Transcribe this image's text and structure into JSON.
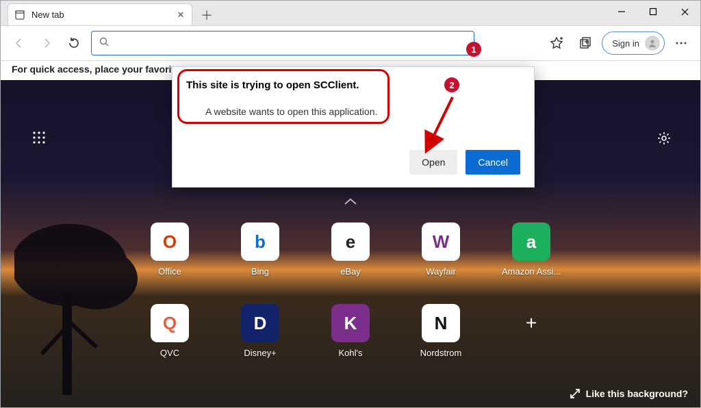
{
  "tab": {
    "title": "New tab"
  },
  "toolbar": {
    "signin_label": "Sign in"
  },
  "favhint": "For quick access, place your favorite",
  "dialog": {
    "title_prefix": "This site is trying to open ",
    "title_app": "SCClient.",
    "subtitle": "A website wants to open this application.",
    "open_label": "Open",
    "cancel_label": "Cancel"
  },
  "tiles": {
    "row1": [
      {
        "label": "Office",
        "bg": "#fff",
        "glyph": "O",
        "glyphColor": "#d83b01"
      },
      {
        "label": "Bing",
        "bg": "#fff",
        "glyph": "b",
        "glyphColor": "#0b6dd4"
      },
      {
        "label": "eBay",
        "bg": "#fff",
        "glyph": "e",
        "glyphColor": "#222"
      },
      {
        "label": "Wayfair",
        "bg": "#fff",
        "glyph": "W",
        "glyphColor": "#7a2e8f"
      },
      {
        "label": "Amazon Assi...",
        "bg": "#1caf5d",
        "glyph": "a",
        "glyphColor": "#fff"
      }
    ],
    "row2": [
      {
        "label": "QVC",
        "bg": "#fff",
        "glyph": "Q",
        "glyphColor": "#e06040"
      },
      {
        "label": "Disney+",
        "bg": "#12236b",
        "glyph": "D",
        "glyphColor": "#fff"
      },
      {
        "label": "Kohl's",
        "bg": "#7b2f8a",
        "glyph": "K",
        "glyphColor": "#fff"
      },
      {
        "label": "Nordstrom",
        "bg": "#fff",
        "glyph": "N",
        "glyphColor": "#111"
      }
    ]
  },
  "likebg": "Like this background?",
  "annotations": {
    "n1": "1",
    "n2": "2"
  }
}
